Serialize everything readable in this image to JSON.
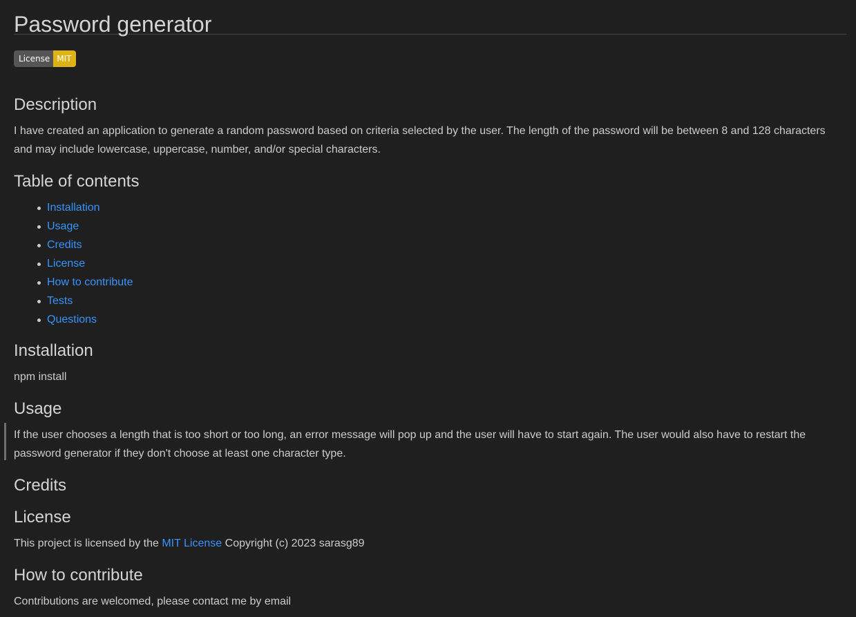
{
  "title": "Password generator",
  "badge": {
    "label": "License",
    "value": "MIT"
  },
  "description": {
    "heading": "Description",
    "text": "I have created an application to generate a random password based on criteria selected by the user. The length of the password will be between 8 and 128 characters and may include lowercase, uppercase, number, and/or special characters."
  },
  "toc": {
    "heading": "Table of contents",
    "items": [
      "Installation",
      "Usage",
      "Credits",
      "License",
      "How to contribute",
      "Tests",
      "Questions"
    ]
  },
  "installation": {
    "heading": "Installation",
    "text": "npm install"
  },
  "usage": {
    "heading": "Usage",
    "text": "If the user chooses a length that is too short or too long, an error message will pop up and the user will have to start again. The user would also have to restart the password generator if they don't choose at least one character type."
  },
  "credits": {
    "heading": "Credits"
  },
  "license": {
    "heading": "License",
    "text_before": "This project is licensed by the ",
    "link": "MIT License",
    "text_after": " Copyright (c) 2023 sarasg89"
  },
  "contribute": {
    "heading": "How to contribute",
    "text": "Contributions are welcomed, please contact me by email"
  }
}
